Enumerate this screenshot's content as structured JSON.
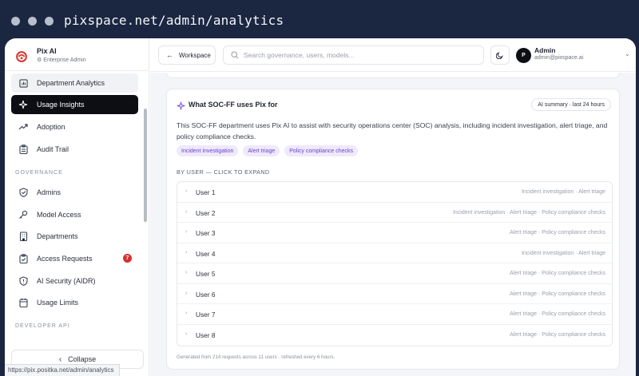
{
  "browser": {
    "url": "pixspace.net/admin/analytics",
    "status_url": "https://pix.positka.net/admin/analytics"
  },
  "brand": {
    "name": "Pix AI",
    "subtitle": "Enterprise Admin",
    "accent": "#d6312b"
  },
  "sidebar": {
    "top_items": [
      {
        "label": "Department Analytics",
        "icon": "chart-icon"
      },
      {
        "label": "Usage Insights",
        "icon": "sparkle-icon"
      },
      {
        "label": "Adoption",
        "icon": "trend-icon"
      },
      {
        "label": "Audit Trail",
        "icon": "clipboard-icon"
      }
    ],
    "governance_label": "GOVERNANCE",
    "governance_items": [
      {
        "label": "Admins",
        "icon": "shield-check-icon"
      },
      {
        "label": "Model Access",
        "icon": "key-icon"
      },
      {
        "label": "Departments",
        "icon": "building-icon"
      },
      {
        "label": "Access Requests",
        "icon": "clipboard-check-icon",
        "badge": "7"
      },
      {
        "label": "AI Security (AIDR)",
        "icon": "shield-alert-icon"
      },
      {
        "label": "Usage Limits",
        "icon": "calendar-icon"
      }
    ],
    "developer_label": "DEVELOPER API",
    "collapse_label": "Collapse"
  },
  "topbar": {
    "workspace_label": "Workspace",
    "search_placeholder": "Search governance, users, models...",
    "user_name": "Admin",
    "user_email": "admin@pixspace.ai",
    "avatar_initial": "P"
  },
  "card": {
    "title": "What SOC-FF uses Pix for",
    "summary_pill": "AI summary · last 24 hours",
    "summary": "This SOC-FF department uses Pix AI to assist with security operations center (SOC) analysis, including incident investigation, alert triage, and policy compliance checks.",
    "tags": [
      "Incident investigation",
      "Alert triage",
      "Policy compliance checks"
    ],
    "by_user_label": "BY USER — CLICK TO EXPAND",
    "users": [
      {
        "name": "User 1",
        "topics": "Incident investigation · Alert triage"
      },
      {
        "name": "User 2",
        "topics": "Incident investigation · Alert triage · Policy compliance checks"
      },
      {
        "name": "User 3",
        "topics": "Alert triage · Policy compliance checks"
      },
      {
        "name": "User 4",
        "topics": "Incident investigation · Alert triage"
      },
      {
        "name": "User 5",
        "topics": "Alert triage · Policy compliance checks"
      },
      {
        "name": "User 6",
        "topics": "Alert triage · Policy compliance checks"
      },
      {
        "name": "User 7",
        "topics": "Alert triage · Policy compliance checks"
      },
      {
        "name": "User 8",
        "topics": "Alert triage · Policy compliance checks"
      }
    ],
    "footnote": "Generated from 214 requests across 11 users · refreshed every 6 hours."
  }
}
